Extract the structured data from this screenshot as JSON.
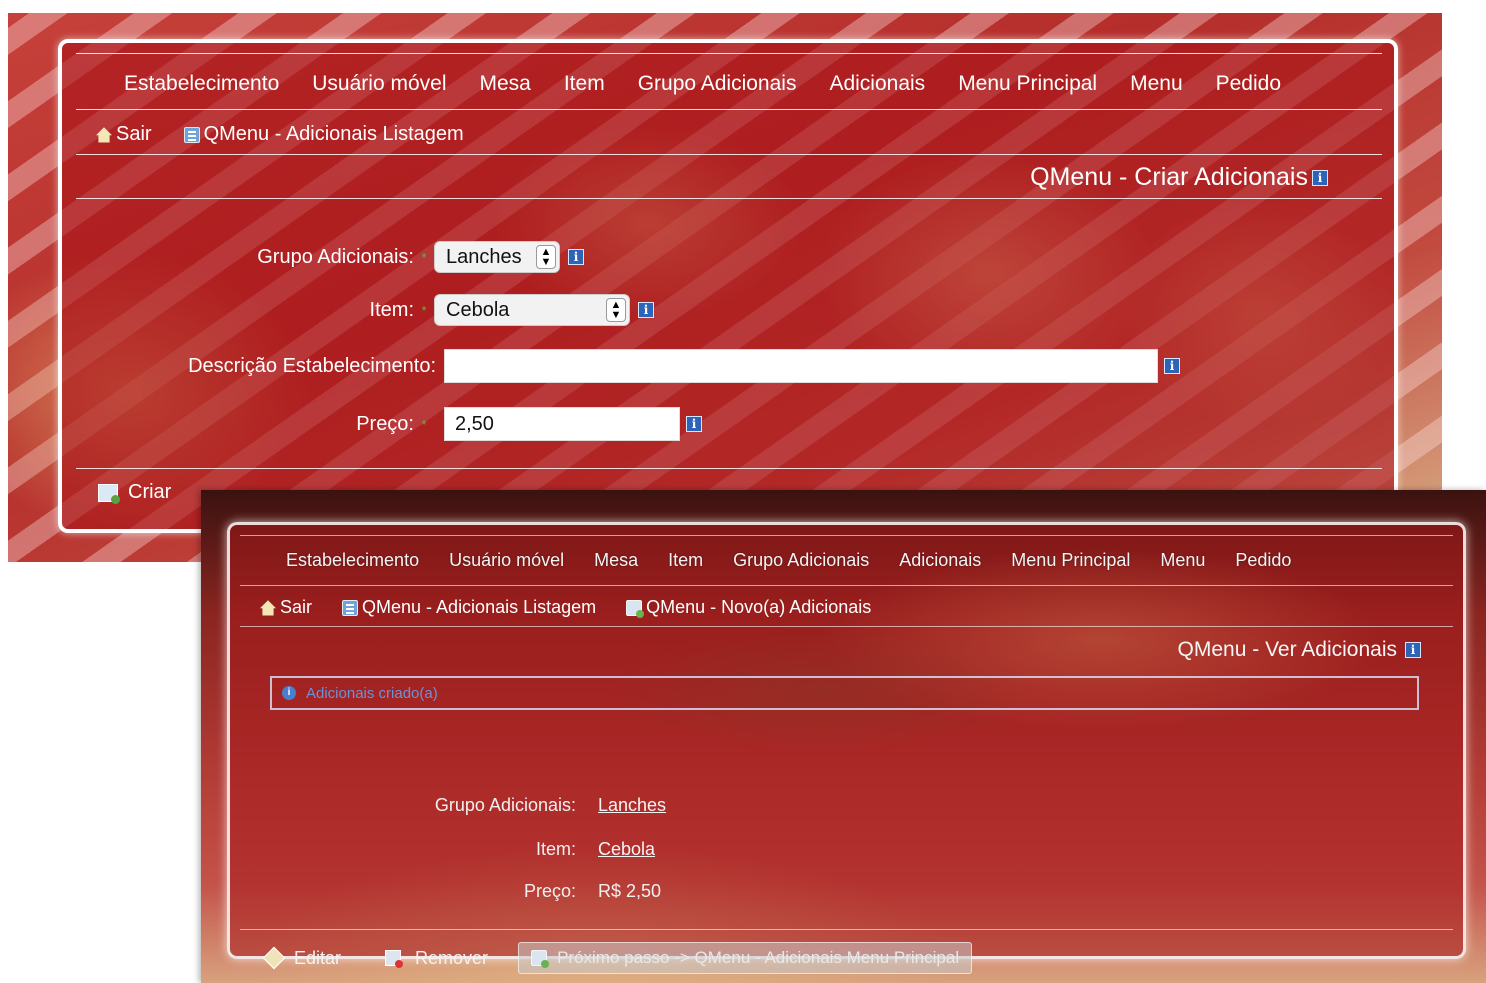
{
  "create_view": {
    "nav": [
      "Estabelecimento",
      "Usuário móvel",
      "Mesa",
      "Item",
      "Grupo Adicionais",
      "Adicionais",
      "Menu Principal",
      "Menu",
      "Pedido"
    ],
    "links": {
      "sair": "Sair",
      "listagem": "QMenu - Adicionais Listagem"
    },
    "title": "QMenu - Criar Adicionais",
    "form": {
      "grupo_label": "Grupo Adicionais:",
      "grupo_value": "Lanches",
      "item_label": "Item:",
      "item_value": "Cebola",
      "descricao_label": "Descrição Estabelecimento:",
      "descricao_value": "",
      "preco_label": "Preço:",
      "preco_value": "2,50",
      "required_mark": "*"
    },
    "criar_label": "Criar"
  },
  "view_view": {
    "nav": [
      "Estabelecimento",
      "Usuário móvel",
      "Mesa",
      "Item",
      "Grupo Adicionais",
      "Adicionais",
      "Menu Principal",
      "Menu",
      "Pedido"
    ],
    "links": {
      "sair": "Sair",
      "listagem": "QMenu - Adicionais Listagem",
      "novo": "QMenu - Novo(a) Adicionais"
    },
    "title": "QMenu - Ver Adicionais",
    "message": "Adicionais criado(a)",
    "fields": {
      "grupo_label": "Grupo Adicionais:",
      "grupo_value": "Lanches",
      "item_label": "Item:",
      "item_value": "Cebola",
      "preco_label": "Preço:",
      "preco_value": "R$ 2,50"
    },
    "actions": {
      "editar": "Editar",
      "remover": "Remover",
      "proximo": "Próximo passo -> QMenu - Adicionais Menu Principal"
    }
  },
  "icons": {
    "home": "home-icon",
    "list": "list-icon",
    "info": "info-icon",
    "new": "new-icon",
    "edit": "edit-icon",
    "remove": "remove-icon"
  },
  "colors": {
    "panel_red": "#a5141a",
    "required_green": "#59b93e",
    "info_blue": "#2d64b8",
    "message_blue": "#6b93d8"
  }
}
